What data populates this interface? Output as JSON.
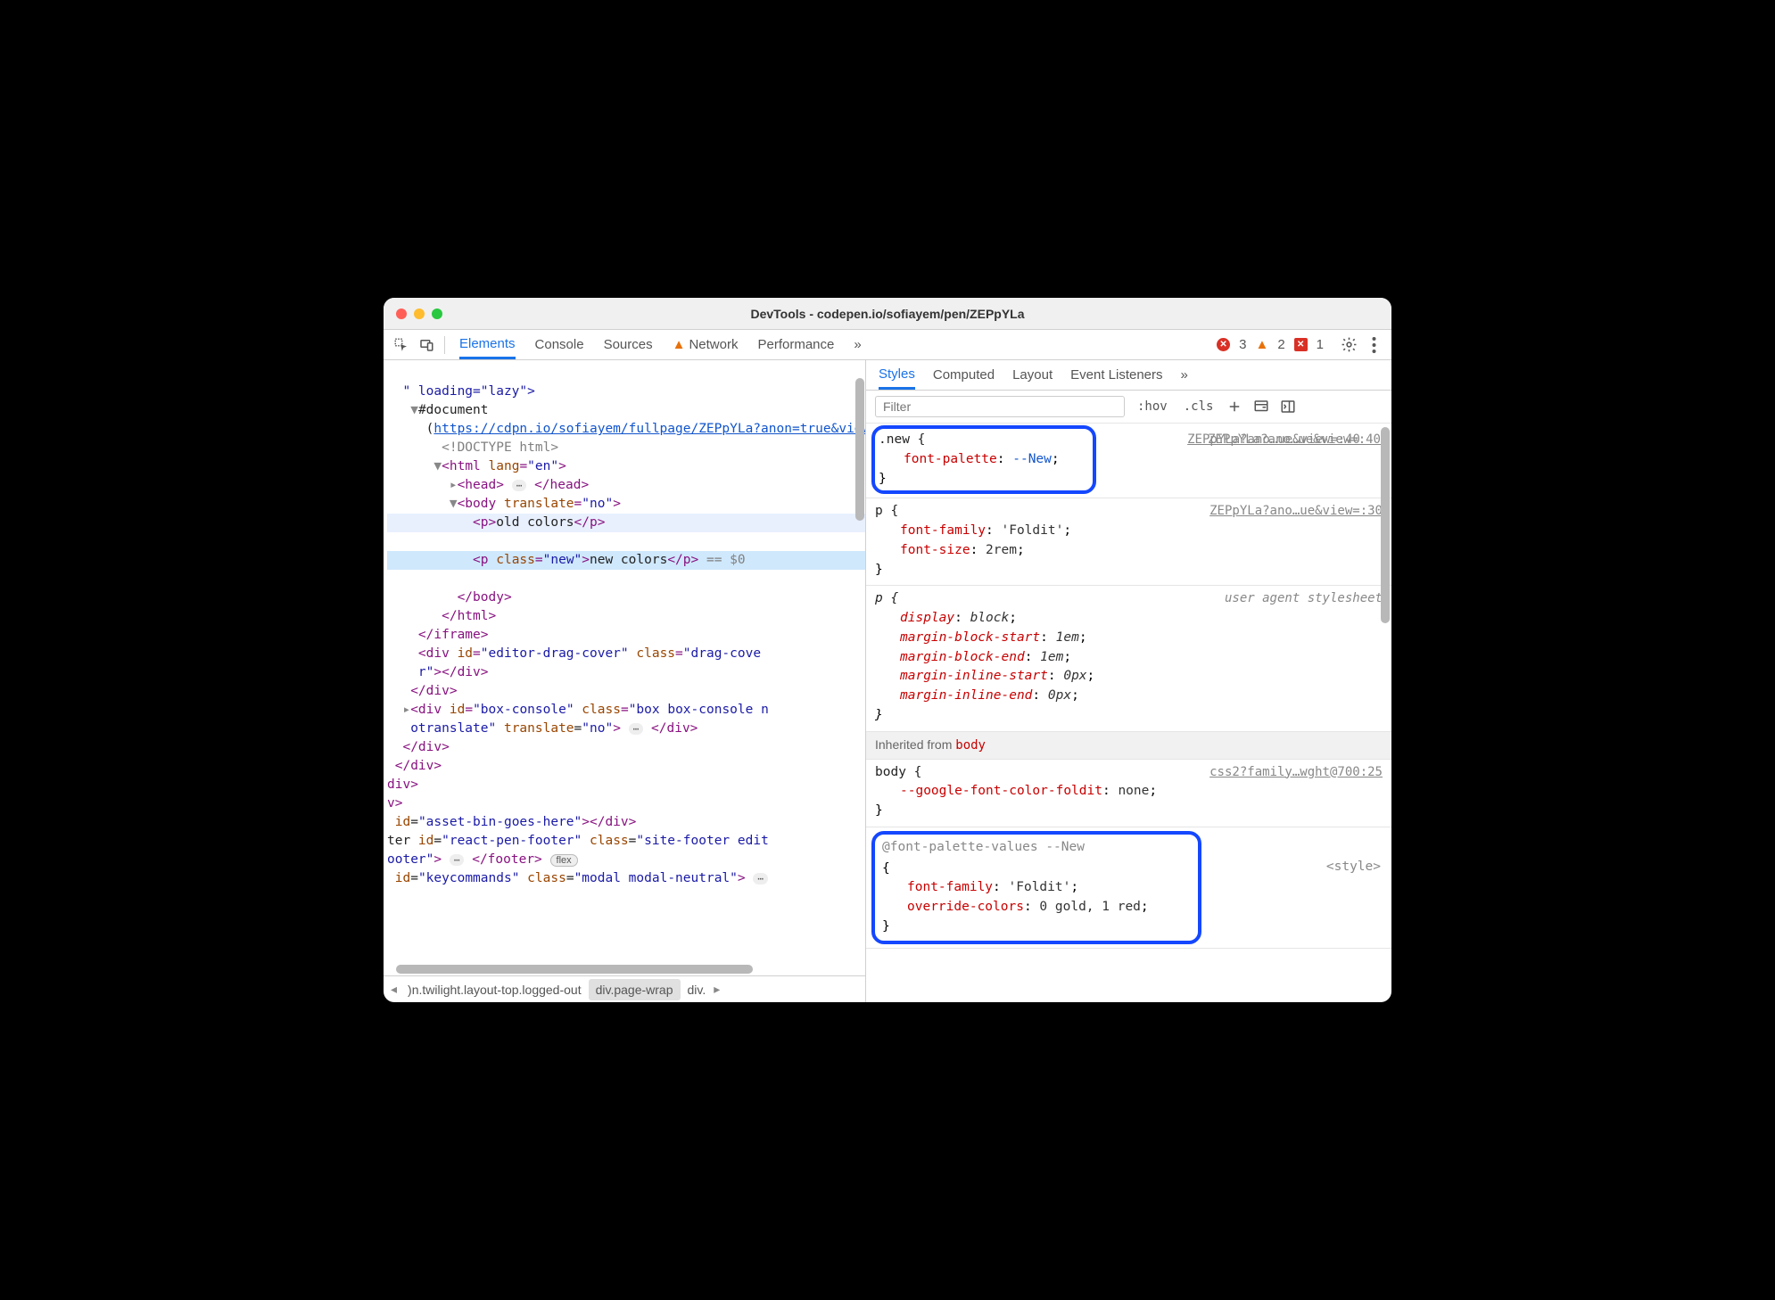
{
  "window_title": "DevTools - codepen.io/sofiayem/pen/ZEPpYLa",
  "main_tabs": [
    "Elements",
    "Console",
    "Sources",
    "Network",
    "Performance"
  ],
  "main_tabs_more": "»",
  "status": {
    "errors": "3",
    "warnings": "2",
    "messages": "1"
  },
  "dom": {
    "iframe_attr": "\" loading=\"lazy\">",
    "doc": "#document",
    "doc_url": "https://cdpn.io/sofiayem/fullpage/ZEPpYLa?anon=true&view=",
    "doctype": "<!DOCTYPE html>",
    "html_open": "<html lang=\"en\">",
    "head": "<head>",
    "head_close": "</head>",
    "body_open": "<body translate=\"no\">",
    "p_old": "<p>old colors</p>",
    "p_new_open": "<p class=\"new\">",
    "p_new_text": "new colors",
    "p_new_close": "</p>",
    "eq0": " == $0",
    "body_close": "</body>",
    "html_close": "</html>",
    "iframe_close": "</iframe>",
    "drag_cover": "<div id=\"editor-drag-cover\" class=\"drag-cover\"></div>",
    "div_close1": "</div>",
    "box_console": "<div id=\"box-console\" class=\"box box-console notranslate\" translate=\"no\">",
    "box_console_close": "</div>",
    "div_close2": "</div>",
    "div_close3": "</div>",
    "stray_div": "div>",
    "stray_v": "v>",
    "asset_bin": " id=\"asset-bin-goes-here\"></div>",
    "footer": "ter id=\"react-pen-footer\" class=\"site-footer edit",
    "footer2": "ooter\">",
    "footer_close": "</footer>",
    "flex_badge": "flex",
    "keycommands": " id=\"keycommands\" class=\"modal modal-neutral\">"
  },
  "breadcrumb": {
    "crumb1": ")n.twilight.layout-top.logged-out",
    "crumb2": "div.page-wrap",
    "crumb3": "div."
  },
  "styles_tabs": [
    "Styles",
    "Computed",
    "Layout",
    "Event Listeners"
  ],
  "styles_tabs_more": "»",
  "filter_placeholder": "Filter",
  "buttons": {
    "hov": ":hov",
    "cls": ".cls"
  },
  "rules": {
    "r1": {
      "sel": ".new {",
      "prop": "font-palette",
      "val": "--New",
      "close": "}",
      "src": "ZEPpYLa?ano…ue&view=:40"
    },
    "r2": {
      "sel": "p {",
      "p1n": "font-family",
      "p1v": "'Foldit'",
      "p2n": "font-size",
      "p2v": "2rem",
      "close": "}",
      "src": "ZEPpYLa?ano…ue&view=:30"
    },
    "r3": {
      "sel": "p {",
      "p1n": "display",
      "p1v": "block",
      "p2n": "margin-block-start",
      "p2v": "1em",
      "p3n": "margin-block-end",
      "p3v": "1em",
      "p4n": "margin-inline-start",
      "p4v": "0px",
      "p5n": "margin-inline-end",
      "p5v": "0px",
      "close": "}",
      "src": "user agent stylesheet"
    },
    "inherited": "Inherited from ",
    "inherited_el": "body",
    "r4": {
      "sel": "body {",
      "p1n": "--google-font-color-foldit",
      "p1v": "none",
      "close": "}",
      "src": "css2?family…wght@700:25"
    },
    "r5": {
      "header": "@font-palette-values --New",
      "open": "{",
      "p1n": "font-family",
      "p1v": "'Foldit'",
      "p2n": "override-colors",
      "p2v": "0 gold, 1 red",
      "close": "}",
      "src": "<style>"
    }
  }
}
